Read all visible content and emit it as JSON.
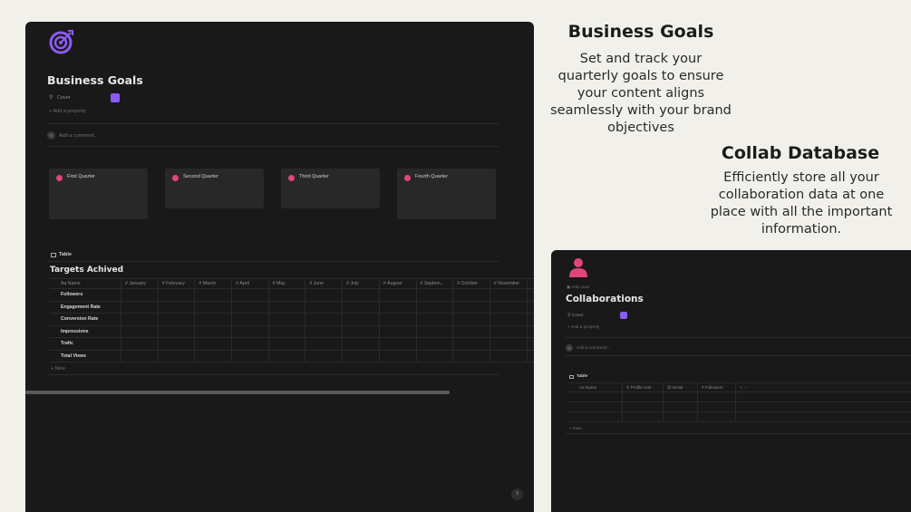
{
  "colors": {
    "accent_purple": "#8b5cf6",
    "dot_pink": "#e0457b",
    "panel_bg": "#191919",
    "page_bg": "#f1f0eb"
  },
  "business_page": {
    "icon": "target-icon",
    "title": "Business Goals",
    "cover_label": "Cover",
    "add_property": "Add a property",
    "add_comment": "Add a comment...",
    "comment_avatar": "N",
    "quarters": [
      "First Quarter",
      "Second Quarter",
      "Third Quarter",
      "Fourth Quarter"
    ],
    "view_tab": "Table",
    "database_title": "Targets Achived",
    "columns": [
      "Name",
      "January",
      "February",
      "March",
      "April",
      "May",
      "June",
      "July",
      "August",
      "Septem...",
      "October",
      "November"
    ],
    "rows": [
      "Followers",
      "Engagement Rate",
      "Conversion Rate",
      "Impressions",
      "Trafic",
      "Total Views"
    ],
    "new_row": "New",
    "help": "?"
  },
  "business_goals_info": {
    "title": "Business Goals",
    "description": "Set and track your quarterly goals to ensure your content aligns seamlessly with your brand objectives"
  },
  "collab_info": {
    "title": "Collab Database",
    "description": "Efficiently store all your collaboration data at one place with all the important information."
  },
  "collab_page": {
    "icon": "person-icon",
    "add_cover": "Add cover",
    "title": "Collaborations",
    "cover_label": "Cover",
    "add_property": "Add a property",
    "add_comment": "Add a comment...",
    "comment_avatar": "N",
    "view_tab": "Table",
    "columns": [
      "Name",
      "Profile Link",
      "Email",
      "Followers"
    ],
    "add_column": "+",
    "more": "···",
    "new_row": "New"
  }
}
